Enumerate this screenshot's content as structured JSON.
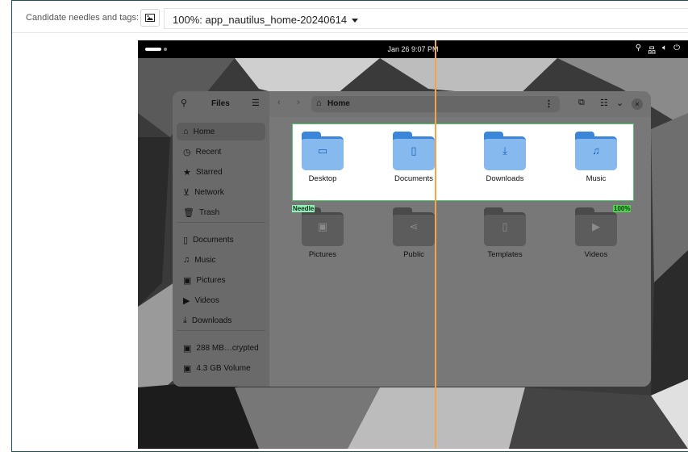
{
  "toolbar": {
    "label": "Candidate needles and tags:",
    "image_icon": "image-icon",
    "selected_needle": "100%: app_nautilus_home-20240614"
  },
  "topbar": {
    "clock": "Jan 26  9:07 PM",
    "icons": [
      "location-icon",
      "network-icon",
      "volume-icon",
      "power-icon"
    ]
  },
  "files_window": {
    "app_title": "Files",
    "path": "Home",
    "sidebar": [
      {
        "label": "Home",
        "icon": "home-icon",
        "active": true
      },
      {
        "label": "Recent",
        "icon": "clock-icon"
      },
      {
        "label": "Starred",
        "icon": "star-icon"
      },
      {
        "label": "Network",
        "icon": "network-icon"
      },
      {
        "label": "Trash",
        "icon": "trash-icon"
      },
      {
        "label": "Documents",
        "icon": "document-icon"
      },
      {
        "label": "Music",
        "icon": "music-icon"
      },
      {
        "label": "Pictures",
        "icon": "picture-icon"
      },
      {
        "label": "Videos",
        "icon": "video-icon"
      },
      {
        "label": "Downloads",
        "icon": "download-icon"
      },
      {
        "label": "288 MB…crypted",
        "icon": "drive-icon"
      },
      {
        "label": "4.3 GB Volume",
        "icon": "drive-icon"
      }
    ],
    "folders": [
      {
        "label": "Desktop",
        "icon": "desktop-folder-icon"
      },
      {
        "label": "Documents",
        "icon": "documents-folder-icon"
      },
      {
        "label": "Downloads",
        "icon": "downloads-folder-icon"
      },
      {
        "label": "Music",
        "icon": "music-folder-icon"
      },
      {
        "label": "Pictures",
        "icon": "pictures-folder-icon"
      },
      {
        "label": "Public",
        "icon": "public-folder-icon"
      },
      {
        "label": "Templates",
        "icon": "templates-folder-icon"
      },
      {
        "label": "Videos",
        "icon": "videos-folder-icon"
      }
    ]
  },
  "overlay": {
    "needle_label": "Needle",
    "match_percent": "100%",
    "match_color": "#4fc76a"
  }
}
